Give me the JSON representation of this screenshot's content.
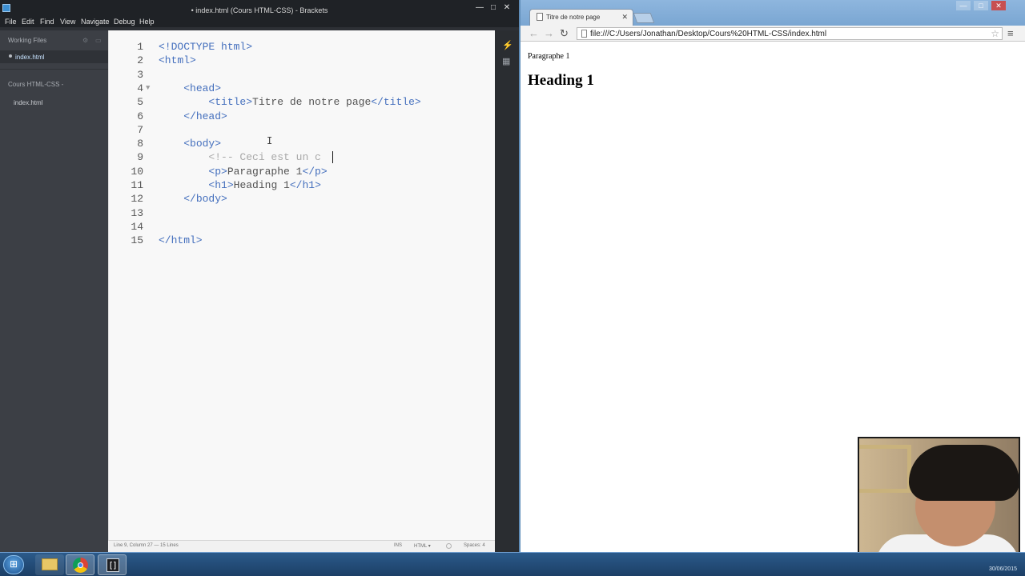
{
  "brackets": {
    "title": "• index.html (Cours HTML-CSS) - Brackets",
    "window_controls": {
      "minimize": "—",
      "maximize": "□",
      "close": "✕"
    },
    "menu": [
      "File",
      "Edit",
      "Find",
      "View",
      "Navigate",
      "Debug",
      "Help"
    ],
    "sidebar": {
      "working_files_label": "Working Files",
      "working_file": "index.html",
      "project_label": "Cours HTML-CSS -",
      "project_file": "index.html"
    },
    "code": [
      {
        "n": "1",
        "segs": [
          [
            "tag",
            "<!DOCTYPE html>"
          ]
        ]
      },
      {
        "n": "2",
        "segs": [
          [
            "tag",
            "<html>"
          ]
        ]
      },
      {
        "n": "3",
        "segs": []
      },
      {
        "n": "4",
        "fold": "▼",
        "segs": [
          [
            "txt",
            "    "
          ],
          [
            "tag",
            "<head>"
          ]
        ]
      },
      {
        "n": "5",
        "segs": [
          [
            "txt",
            "        "
          ],
          [
            "tag",
            "<title>"
          ],
          [
            "txt",
            "Titre de notre page"
          ],
          [
            "tag",
            "</title>"
          ]
        ]
      },
      {
        "n": "6",
        "segs": [
          [
            "txt",
            "    "
          ],
          [
            "tag",
            "</head>"
          ]
        ]
      },
      {
        "n": "7",
        "segs": []
      },
      {
        "n": "8",
        "segs": [
          [
            "txt",
            "    "
          ],
          [
            "tag",
            "<body>"
          ]
        ]
      },
      {
        "n": "9",
        "segs": [
          [
            "txt",
            "        "
          ],
          [
            "cmt",
            "<!-- Ceci est un c"
          ]
        ]
      },
      {
        "n": "10",
        "segs": [
          [
            "txt",
            "        "
          ],
          [
            "tag",
            "<p>"
          ],
          [
            "txt",
            "Paragraphe 1"
          ],
          [
            "tag",
            "</p>"
          ]
        ]
      },
      {
        "n": "11",
        "segs": [
          [
            "txt",
            "        "
          ],
          [
            "tag",
            "<h1>"
          ],
          [
            "txt",
            "Heading 1"
          ],
          [
            "tag",
            "</h1>"
          ]
        ]
      },
      {
        "n": "12",
        "segs": [
          [
            "txt",
            "    "
          ],
          [
            "tag",
            "</body>"
          ]
        ]
      },
      {
        "n": "13",
        "segs": []
      },
      {
        "n": "14",
        "segs": []
      },
      {
        "n": "15",
        "segs": [
          [
            "tag",
            "</html>"
          ]
        ]
      }
    ],
    "status": {
      "cursor": "Line 9, Column 27 — 15 Lines",
      "mode": "INS",
      "language": "HTML ▾",
      "spaces": "Spaces: 4"
    },
    "toolbar_icons": [
      "live-preview-icon",
      "extension-manager-icon"
    ]
  },
  "browser": {
    "tab_title": "Titre de notre page",
    "tab_close": "✕",
    "url": "file:///C:/Users/Jonathan/Desktop/Cours%20HTML-CSS/index.html",
    "nav": {
      "back": "←",
      "forward": "→",
      "reload": "↻"
    },
    "star": "☆",
    "menu": "≡",
    "window_controls": {
      "minimize": "—",
      "maximize": "□",
      "close": "✕"
    },
    "page": {
      "paragraph": "Paragraphe 1",
      "heading": "Heading 1"
    }
  },
  "taskbar": {
    "date": "30/06/2015"
  },
  "colors": {
    "code_tag": "#446fbd",
    "code_text": "#535353",
    "code_comment": "#a9a9a9",
    "brackets_dark": "#2d3035",
    "browser_frame": "#7aa6d2"
  }
}
